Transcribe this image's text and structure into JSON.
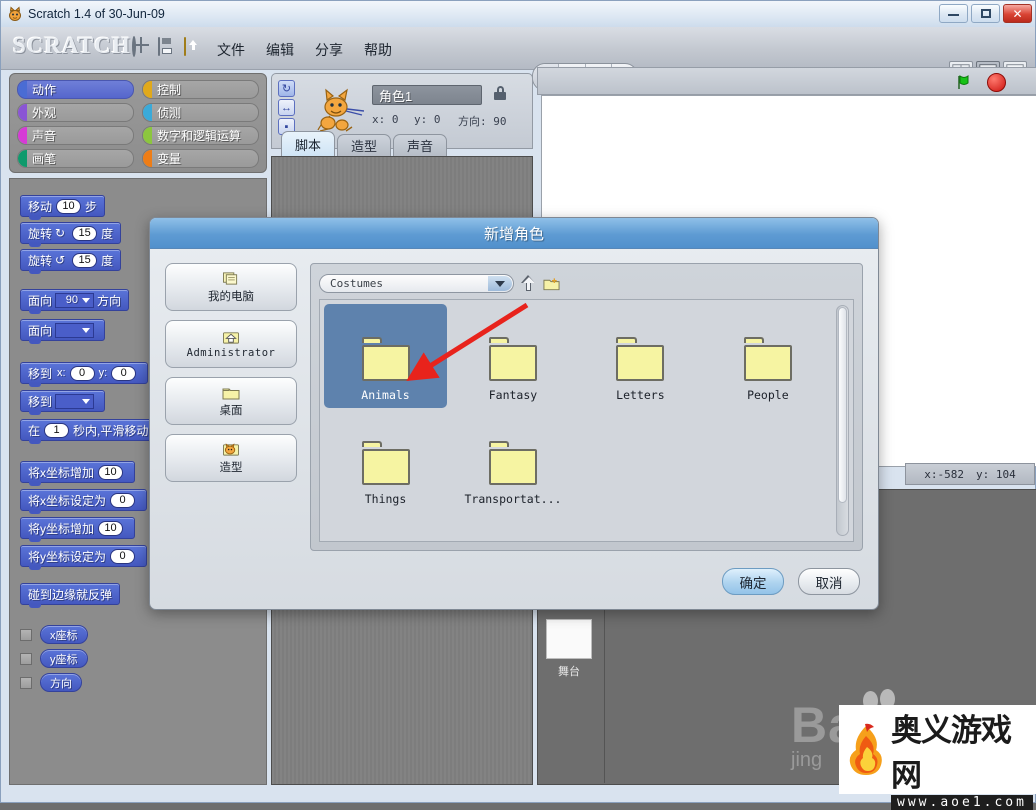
{
  "window": {
    "title": "Scratch 1.4 of 30-Jun-09",
    "app_icon": "scratch-cat-icon",
    "controls": {
      "minimize": "minimize",
      "maximize": "maximize",
      "close": "close"
    }
  },
  "menubar": {
    "logo": "SCRATCH",
    "icons": [
      {
        "name": "globe-icon"
      },
      {
        "name": "save-icon"
      },
      {
        "name": "share-upload-icon"
      }
    ],
    "menus": [
      {
        "label": "文件"
      },
      {
        "label": "编辑"
      },
      {
        "label": "分享"
      },
      {
        "label": "帮助"
      }
    ],
    "tools": [
      {
        "name": "stamp-tool-icon"
      },
      {
        "name": "scissors-tool-icon"
      },
      {
        "name": "grow-tool-icon"
      },
      {
        "name": "shrink-tool-icon"
      }
    ],
    "view_modes": [
      {
        "name": "small-stage-view"
      },
      {
        "name": "normal-stage-view"
      },
      {
        "name": "presentation-view"
      }
    ]
  },
  "palette": {
    "categories": [
      {
        "label": "动作",
        "color": "#4a6cd4",
        "active": true
      },
      {
        "label": "控制",
        "color": "#e1a91a",
        "active": false
      },
      {
        "label": "外观",
        "color": "#8a55d5",
        "active": false
      },
      {
        "label": "侦测",
        "color": "#3aaad9",
        "active": false
      },
      {
        "label": "声音",
        "color": "#d63ad6",
        "active": false
      },
      {
        "label": "数字和逻辑运算",
        "color": "#8cc63e",
        "active": false
      },
      {
        "label": "画笔",
        "color": "#0e9a6c",
        "active": false
      },
      {
        "label": "变量",
        "color": "#ee7d16",
        "active": false
      }
    ],
    "blocks": [
      {
        "id": "move",
        "parts": [
          {
            "t": "text",
            "v": "移动"
          },
          {
            "t": "num",
            "v": "10"
          },
          {
            "t": "text",
            "v": "步"
          }
        ]
      },
      {
        "id": "turn_cw",
        "parts": [
          {
            "t": "text",
            "v": "旋转"
          },
          {
            "t": "glyph",
            "v": "↻"
          },
          {
            "t": "num",
            "v": "15"
          },
          {
            "t": "text",
            "v": "度"
          }
        ]
      },
      {
        "id": "turn_ccw",
        "parts": [
          {
            "t": "text",
            "v": "旋转"
          },
          {
            "t": "glyph",
            "v": "↺"
          },
          {
            "t": "num",
            "v": "15"
          },
          {
            "t": "text",
            "v": "度"
          }
        ]
      },
      {
        "id": "point_dir",
        "parts": [
          {
            "t": "text",
            "v": "面向"
          },
          {
            "t": "drop",
            "v": "90"
          },
          {
            "t": "text",
            "v": "方向"
          }
        ]
      },
      {
        "id": "point_to",
        "parts": [
          {
            "t": "text",
            "v": "面向"
          },
          {
            "t": "drop",
            "v": ""
          }
        ]
      },
      {
        "id": "goto_xy",
        "parts": [
          {
            "t": "text",
            "v": "移到"
          },
          {
            "t": "small",
            "v": "x:"
          },
          {
            "t": "num",
            "v": "0"
          },
          {
            "t": "small",
            "v": "y:"
          },
          {
            "t": "num",
            "v": "0"
          }
        ]
      },
      {
        "id": "goto_obj",
        "parts": [
          {
            "t": "text",
            "v": "移到"
          },
          {
            "t": "drop",
            "v": ""
          }
        ]
      },
      {
        "id": "glide",
        "parts": [
          {
            "t": "text",
            "v": "在"
          },
          {
            "t": "num",
            "v": "1"
          },
          {
            "t": "text",
            "v": "秒内,平滑移动到"
          }
        ]
      },
      {
        "id": "change_x",
        "parts": [
          {
            "t": "text",
            "v": "将x坐标增加"
          },
          {
            "t": "num",
            "v": "10"
          }
        ]
      },
      {
        "id": "set_x",
        "parts": [
          {
            "t": "text",
            "v": "将x坐标设定为"
          },
          {
            "t": "num",
            "v": "0"
          }
        ]
      },
      {
        "id": "change_y",
        "parts": [
          {
            "t": "text",
            "v": "将y坐标增加"
          },
          {
            "t": "num",
            "v": "10"
          }
        ]
      },
      {
        "id": "set_y",
        "parts": [
          {
            "t": "text",
            "v": "将y坐标设定为"
          },
          {
            "t": "num",
            "v": "0"
          }
        ]
      },
      {
        "id": "bounce",
        "parts": [
          {
            "t": "text",
            "v": "碰到边缘就反弹"
          }
        ]
      }
    ],
    "watchers": [
      {
        "label": "x座标",
        "checked": false
      },
      {
        "label": "y座标",
        "checked": false
      },
      {
        "label": "方向",
        "checked": false
      }
    ]
  },
  "sprite_pane": {
    "name": "角色1",
    "x_label": "x: 0",
    "y_label": "y: 0",
    "direction_label": "方向: 90",
    "lock_icon": "lock-icon",
    "rotation_buttons": [
      {
        "name": "rotate-freely-button",
        "glyph": "↻",
        "selected": true
      },
      {
        "name": "left-right-flip-button",
        "glyph": "↔",
        "selected": false
      },
      {
        "name": "no-rotate-button",
        "glyph": "▪",
        "selected": false
      }
    ],
    "tabs": [
      {
        "label": "脚本",
        "selected": true
      },
      {
        "label": "造型",
        "selected": false
      },
      {
        "label": "声音",
        "selected": false
      }
    ]
  },
  "stage": {
    "green_flag": "green-flag-icon",
    "stop_button": "stop-sign-icon",
    "mouse_x": "x:-582",
    "mouse_y": "y: 104",
    "thumb_label": "舞台"
  },
  "dialog": {
    "title": "新增角色",
    "places": [
      {
        "label": "我的电脑",
        "icon": "computer-icon",
        "mono": false
      },
      {
        "label": "Administrator",
        "icon": "home-folder-icon",
        "mono": true
      },
      {
        "label": "桌面",
        "icon": "folder-icon",
        "mono": false
      },
      {
        "label": "造型",
        "icon": "costumes-cat-icon",
        "mono": false
      }
    ],
    "path_dropdown": {
      "value": "Costumes",
      "arrow_icon": "chevron-down-icon"
    },
    "toolbar": [
      {
        "name": "up-one-level-icon"
      },
      {
        "name": "new-folder-icon"
      }
    ],
    "files": [
      {
        "name": "Animals",
        "type": "folder",
        "selected": true
      },
      {
        "name": "Fantasy",
        "type": "folder",
        "selected": false
      },
      {
        "name": "Letters",
        "type": "folder",
        "selected": false
      },
      {
        "name": "People",
        "type": "folder",
        "selected": false
      },
      {
        "name": "Things",
        "type": "folder",
        "selected": false
      },
      {
        "name": "Transportat...",
        "type": "folder",
        "selected": false
      }
    ],
    "buttons": [
      {
        "label": "确定",
        "primary": true
      },
      {
        "label": "取消",
        "primary": false
      }
    ],
    "annotation": {
      "name": "red-arrow-annotation",
      "color": "#e8231c"
    }
  },
  "watermark": {
    "背景_big": "Ba",
    "背景_small": "jing",
    "logo_cn": "奥义游戏网",
    "logo_url": "www.aoe1.com"
  }
}
